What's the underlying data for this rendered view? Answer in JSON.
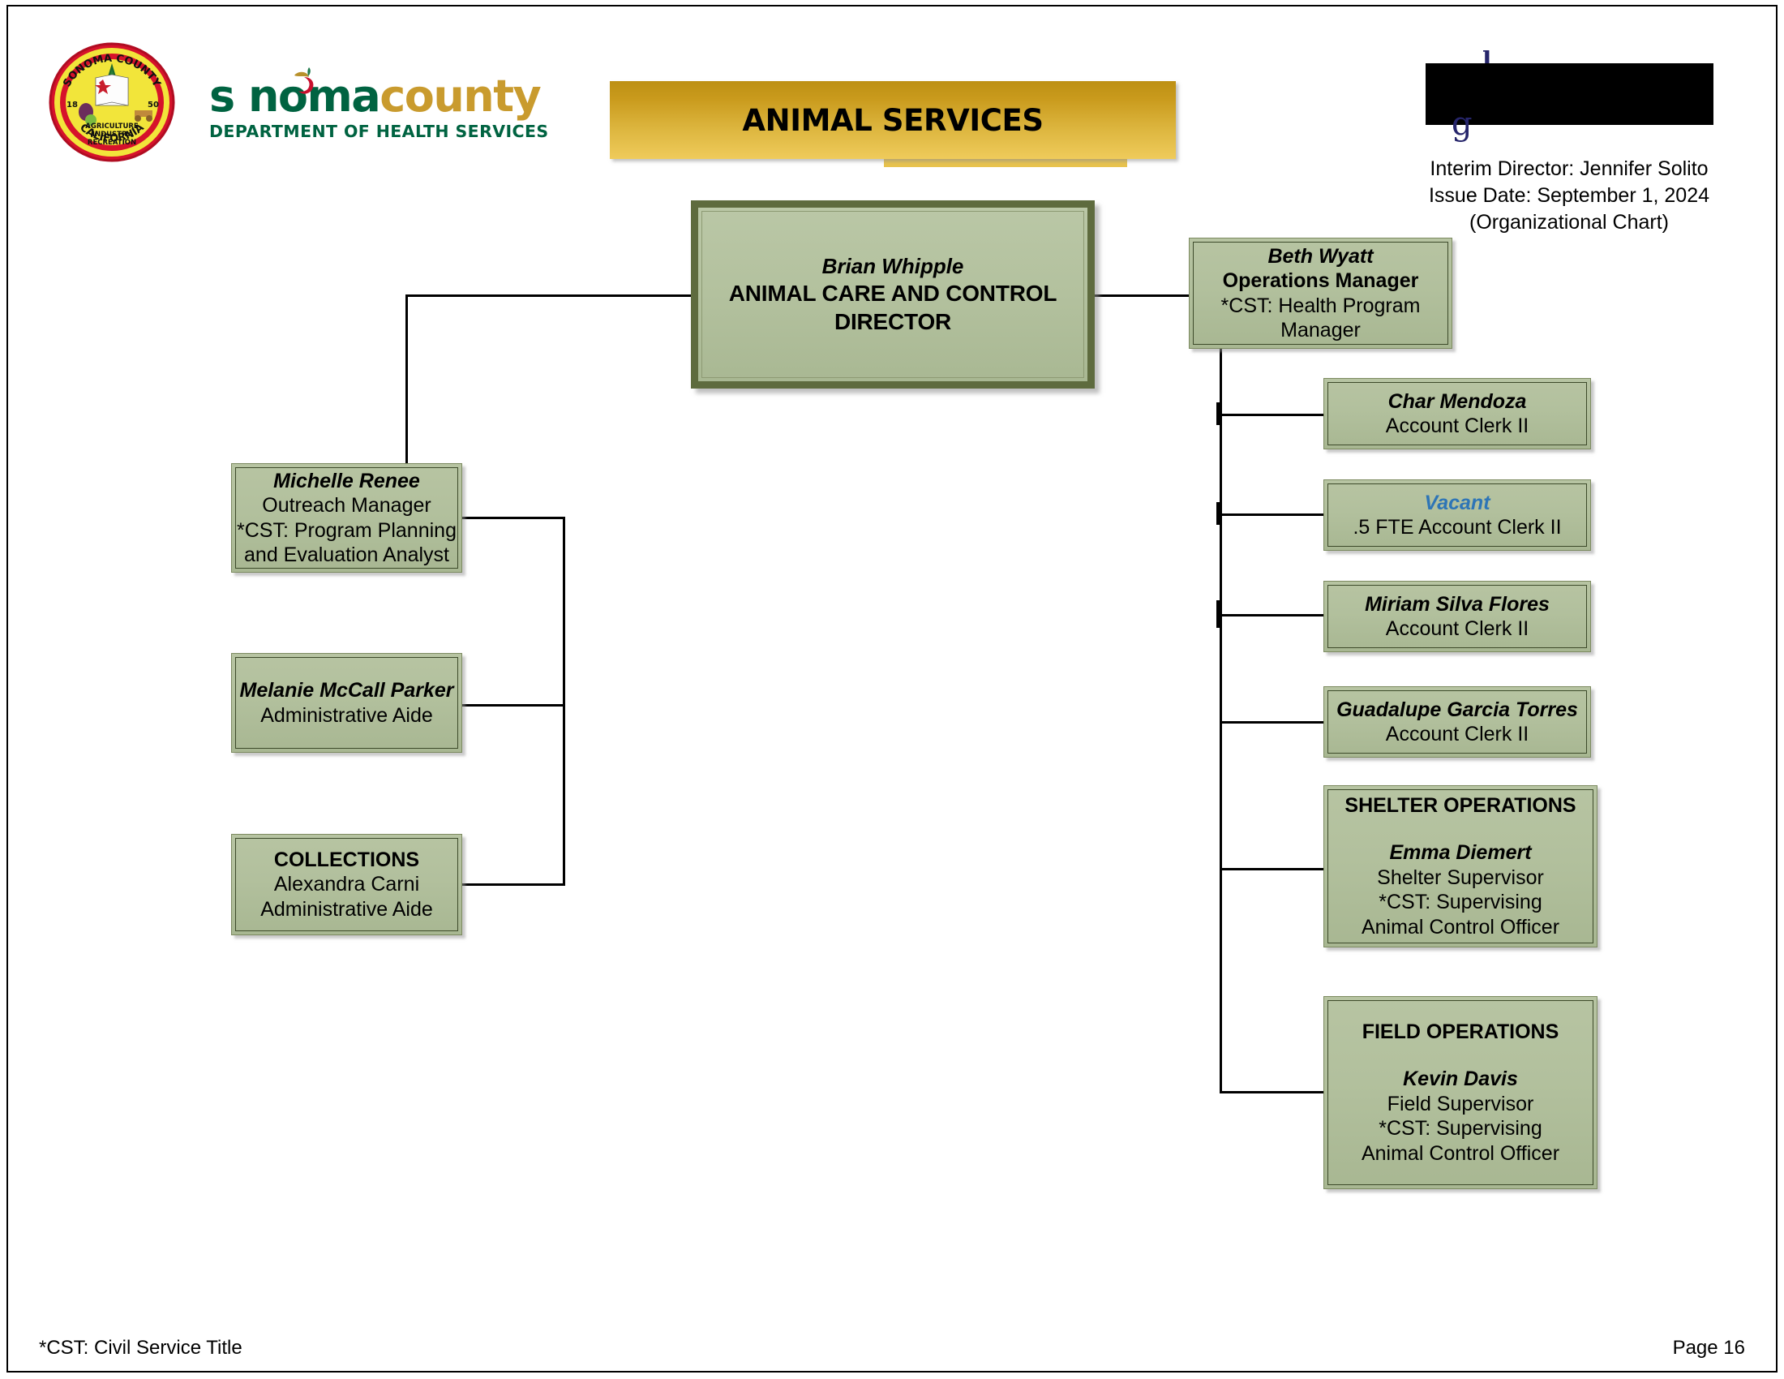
{
  "page": {
    "banner_title": "ANIMAL SERVICES",
    "accent_gold": "#D4A62A",
    "node_fill": "#B2C09D",
    "node_border": "#3D4A2A",
    "vacant_color": "#2E75B6"
  },
  "logo": {
    "word_sonoma": "s",
    "word_sonoma_rest": "noma",
    "word_county": "county",
    "subtitle": "DEPARTMENT OF HEALTH SERVICES",
    "seal_name": "sonoma-county-seal"
  },
  "header": {
    "interim_director": "Interim Director: Jennifer Solito",
    "issue_date": "Issue Date: September 1, 2024",
    "doc_type": "(Organizational Chart)"
  },
  "director": {
    "name": "Brian Whipple",
    "title": "ANIMAL CARE AND CONTROL DIRECTOR"
  },
  "operations_manager": {
    "name": "Beth Wyatt",
    "title": "Operations Manager",
    "cst_line1": "*CST: Health Program",
    "cst_line2": "Manager"
  },
  "left_column": [
    {
      "name": "Michelle Renee",
      "title": "Outreach Manager",
      "cst_line1": "*CST: Program Planning",
      "cst_line2": "and Evaluation Analyst"
    },
    {
      "name": "Melanie McCall Parker",
      "title": "Administrative Aide"
    },
    {
      "header": "COLLECTIONS",
      "person": "Alexandra Carni",
      "title": "Administrative Aide"
    }
  ],
  "right_column": [
    {
      "name": "Char Mendoza",
      "title": "Account Clerk II",
      "vacant": false
    },
    {
      "name": "Vacant",
      "title": ".5 FTE Account Clerk II",
      "vacant": true
    },
    {
      "name": "Miriam Silva Flores",
      "title": "Account Clerk II",
      "vacant": false
    },
    {
      "name": "Guadalupe Garcia Torres",
      "title": "Account Clerk II",
      "vacant": false
    }
  ],
  "operations_units": [
    {
      "header": "SHELTER OPERATIONS",
      "name": "Emma Diemert",
      "title": "Shelter Supervisor",
      "cst_line1": "*CST: Supervising",
      "cst_line2": "Animal Control Officer"
    },
    {
      "header": "FIELD OPERATIONS",
      "name": "Kevin Davis",
      "title": "Field Supervisor",
      "cst_line1": "*CST: Supervising",
      "cst_line2": "Animal Control Officer"
    }
  ],
  "footer": {
    "legend": "*CST: Civil Service Title",
    "page": "Page 16"
  }
}
